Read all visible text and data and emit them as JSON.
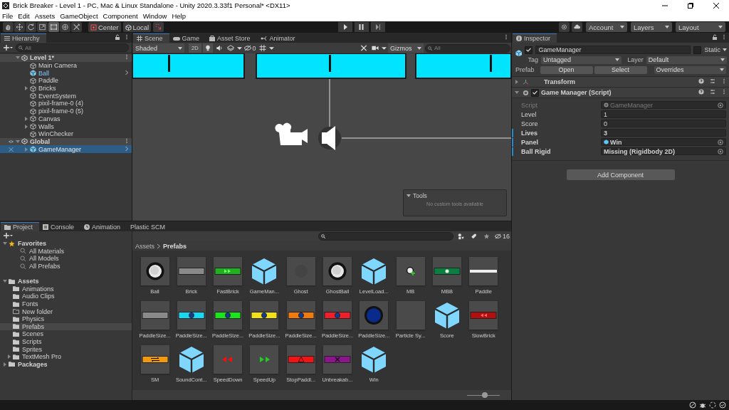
{
  "window": {
    "title": "Brick Breaker - Level 1 - PC, Mac & Linux Standalone - Unity 2020.3.33f1 Personal* <DX11>"
  },
  "menu": [
    "File",
    "Edit",
    "Assets",
    "GameObject",
    "Component",
    "Window",
    "Help"
  ],
  "toolbar": {
    "pivot": "Center",
    "space": "Local",
    "account": "Account",
    "layers": "Layers",
    "layout": "Layout"
  },
  "hierarchy": {
    "title": "Hierarchy",
    "search_placeholder": "All",
    "scenes": [
      {
        "name": "Level 1*",
        "expanded": true,
        "children": [
          {
            "name": "Main Camera",
            "prefab": false,
            "selected": false
          },
          {
            "name": "Ball",
            "prefab": true,
            "selected": false
          },
          {
            "name": "Paddle",
            "prefab": false,
            "selected": false
          },
          {
            "name": "Bricks",
            "prefab": false,
            "selected": false,
            "expanded": false
          },
          {
            "name": "EventSystem",
            "prefab": false,
            "selected": false
          },
          {
            "name": "pixil-frame-0 (4)",
            "prefab": false,
            "selected": false
          },
          {
            "name": "pixil-frame-0 (5)",
            "prefab": false,
            "selected": false
          },
          {
            "name": "Canvas",
            "prefab": false,
            "selected": false,
            "expanded": false
          },
          {
            "name": "Walls",
            "prefab": false,
            "selected": false,
            "expanded": false
          },
          {
            "name": "WinChecker",
            "prefab": false,
            "selected": false
          }
        ]
      },
      {
        "name": "Global",
        "expanded": true,
        "children": [
          {
            "name": "GameManager",
            "prefab": true,
            "selected": true,
            "expanded": false
          }
        ]
      }
    ]
  },
  "scene_tabs": [
    {
      "label": "Scene",
      "selected": true
    },
    {
      "label": "Game",
      "selected": false
    },
    {
      "label": "Asset Store",
      "selected": false
    },
    {
      "label": "Animator",
      "selected": false
    }
  ],
  "scene_toolbar": {
    "shading": "Shaded",
    "mode_2d": "2D",
    "hidden_count": "0",
    "gizmos": "Gizmos",
    "search_placeholder": "All"
  },
  "tools_overlay": {
    "title": "Tools",
    "message": "No custom tools available"
  },
  "inspector": {
    "title": "Inspector",
    "object_name": "GameManager",
    "active": true,
    "static_label": "Static",
    "static": false,
    "tag_label": "Tag",
    "tag": "Untagged",
    "layer_label": "Layer",
    "layer": "Default",
    "prefab_label": "Prefab",
    "open": "Open",
    "select": "Select",
    "overrides": "Overrides",
    "components": [
      {
        "name": "Transform",
        "expanded": false
      },
      {
        "name": "Game Manager (Script)",
        "expanded": true,
        "enabled": true
      }
    ],
    "fields": [
      {
        "label": "Script",
        "value": "GameManager",
        "kind": "script",
        "overridden": false
      },
      {
        "label": "Level",
        "value": "1",
        "kind": "text",
        "overridden": false
      },
      {
        "label": "Score",
        "value": "0",
        "kind": "text",
        "overridden": false
      },
      {
        "label": "Lives",
        "value": "3",
        "kind": "text",
        "overridden": true
      },
      {
        "label": "Panel",
        "value": "Win",
        "kind": "prefab",
        "overridden": true
      },
      {
        "label": "Ball Rigid",
        "value": "Missing (Rigidbody 2D)",
        "kind": "object",
        "overridden": true
      }
    ],
    "add_component": "Add Component"
  },
  "project": {
    "tabs": [
      {
        "label": "Project",
        "selected": true
      },
      {
        "label": "Console",
        "selected": false
      },
      {
        "label": "Animation",
        "selected": false
      },
      {
        "label": "Plastic SCM",
        "selected": false
      }
    ],
    "hidden_count": "16",
    "tree": [
      {
        "label": "Favorites",
        "kind": "favorites",
        "expanded": true,
        "selected": false,
        "children": [
          {
            "label": "All Materials",
            "kind": "search",
            "selected": false
          },
          {
            "label": "All Models",
            "kind": "search",
            "selected": false
          },
          {
            "label": "All Prefabs",
            "kind": "search",
            "selected": false
          }
        ]
      },
      {
        "label": "Assets",
        "kind": "folder",
        "expanded": true,
        "selected": false,
        "children": [
          {
            "label": "Animations",
            "kind": "folder",
            "selected": false
          },
          {
            "label": "Audio Clips",
            "kind": "folder",
            "selected": false
          },
          {
            "label": "Fonts",
            "kind": "folder",
            "selected": false
          },
          {
            "label": "New folder",
            "kind": "empty-folder",
            "selected": false
          },
          {
            "label": "Physics",
            "kind": "folder",
            "selected": false
          },
          {
            "label": "Prefabs",
            "kind": "folder",
            "selected": true
          },
          {
            "label": "Scenes",
            "kind": "folder",
            "selected": false
          },
          {
            "label": "Scripts",
            "kind": "folder",
            "selected": false
          },
          {
            "label": "Sprites",
            "kind": "folder",
            "selected": false
          },
          {
            "label": "TextMesh Pro",
            "kind": "folder",
            "selected": false,
            "expanded": false
          }
        ]
      },
      {
        "label": "Packages",
        "kind": "folder",
        "expanded": false,
        "selected": false
      }
    ],
    "breadcrumb": [
      "Assets",
      "Prefabs"
    ],
    "items": [
      {
        "label": "Ball",
        "kind": "ball"
      },
      {
        "label": "Brick",
        "kind": "bar",
        "color": "#8a8a8a"
      },
      {
        "label": "FastBrick",
        "kind": "bar-fast",
        "color": "#1fb21f"
      },
      {
        "label": "GameMan...",
        "kind": "cube"
      },
      {
        "label": "Ghost",
        "kind": "ghost"
      },
      {
        "label": "GhostBall",
        "kind": "ball"
      },
      {
        "label": "LevelLoad...",
        "kind": "cube"
      },
      {
        "label": "MB",
        "kind": "mb"
      },
      {
        "label": "MBB",
        "kind": "bar-ball",
        "color": "#0a8040"
      },
      {
        "label": "Paddle",
        "kind": "line"
      },
      {
        "label": "PaddleSize...",
        "kind": "bar",
        "color": "#8a8a8a"
      },
      {
        "label": "PaddleSize...",
        "kind": "bar-dot",
        "color": "#19d9f2"
      },
      {
        "label": "PaddleSize...",
        "kind": "bar-dot",
        "color": "#19e619"
      },
      {
        "label": "PaddleSize...",
        "kind": "bar-dot",
        "color": "#f2e119"
      },
      {
        "label": "PaddleSize...",
        "kind": "bar-dot",
        "color": "#f27a0d"
      },
      {
        "label": "PaddleSize...",
        "kind": "bar-dot",
        "color": "#f21f2b"
      },
      {
        "label": "PaddleSize...",
        "kind": "disc"
      },
      {
        "label": "Particle Sy...",
        "kind": "blank"
      },
      {
        "label": "Score",
        "kind": "cube"
      },
      {
        "label": "SlowBrick",
        "kind": "bar-slow",
        "color": "#b30d0d"
      },
      {
        "label": "SM",
        "kind": "bar-swap",
        "color": "#f29a0d"
      },
      {
        "label": "SoundCont...",
        "kind": "cube"
      },
      {
        "label": "SpeedDown",
        "kind": "arrows-left"
      },
      {
        "label": "SpeedUp",
        "kind": "arrows-right"
      },
      {
        "label": "StopPaddl...",
        "kind": "bar-warning",
        "color": "#f21414"
      },
      {
        "label": "Unbreakab...",
        "kind": "bar-x",
        "color": "#8c148c"
      },
      {
        "label": "Win",
        "kind": "cube"
      }
    ],
    "zoom_slider": {
      "level": 0.55
    }
  }
}
